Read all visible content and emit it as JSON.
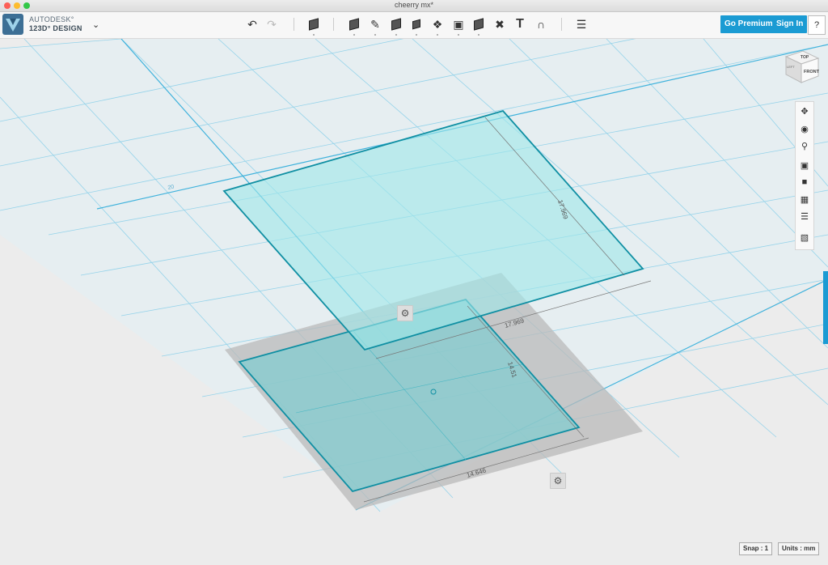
{
  "window": {
    "title": "cheerry mx*"
  },
  "brand": {
    "line1": "AUTODESK°",
    "line2": "123D° DESIGN"
  },
  "toolbar": {
    "undo_icon": "undo-icon",
    "redo_icon": "redo-icon",
    "tools": [
      "new-object",
      "primitives",
      "sketch",
      "construct",
      "modify",
      "pattern",
      "grouping",
      "combine",
      "measure",
      "text",
      "snap",
      "material"
    ],
    "go_premium_label": "Go Premium",
    "sign_in_label": "Sign In",
    "help_label": "?"
  },
  "viewcube": {
    "top": "TOP",
    "front": "FRONT",
    "left": "LEFT"
  },
  "scene": {
    "grid_label": "20",
    "upper_width": "17.969",
    "upper_depth": "17.969",
    "lower_width": "14.646",
    "lower_depth": "14.51"
  },
  "status": {
    "snap": "Snap : 1",
    "units": "Units : mm"
  },
  "colors": {
    "accent": "#1b9bd3",
    "sketch_fill": "#8ee3e5",
    "sketch_edge": "#0f8fa3",
    "grid": "#7ccbe6"
  }
}
